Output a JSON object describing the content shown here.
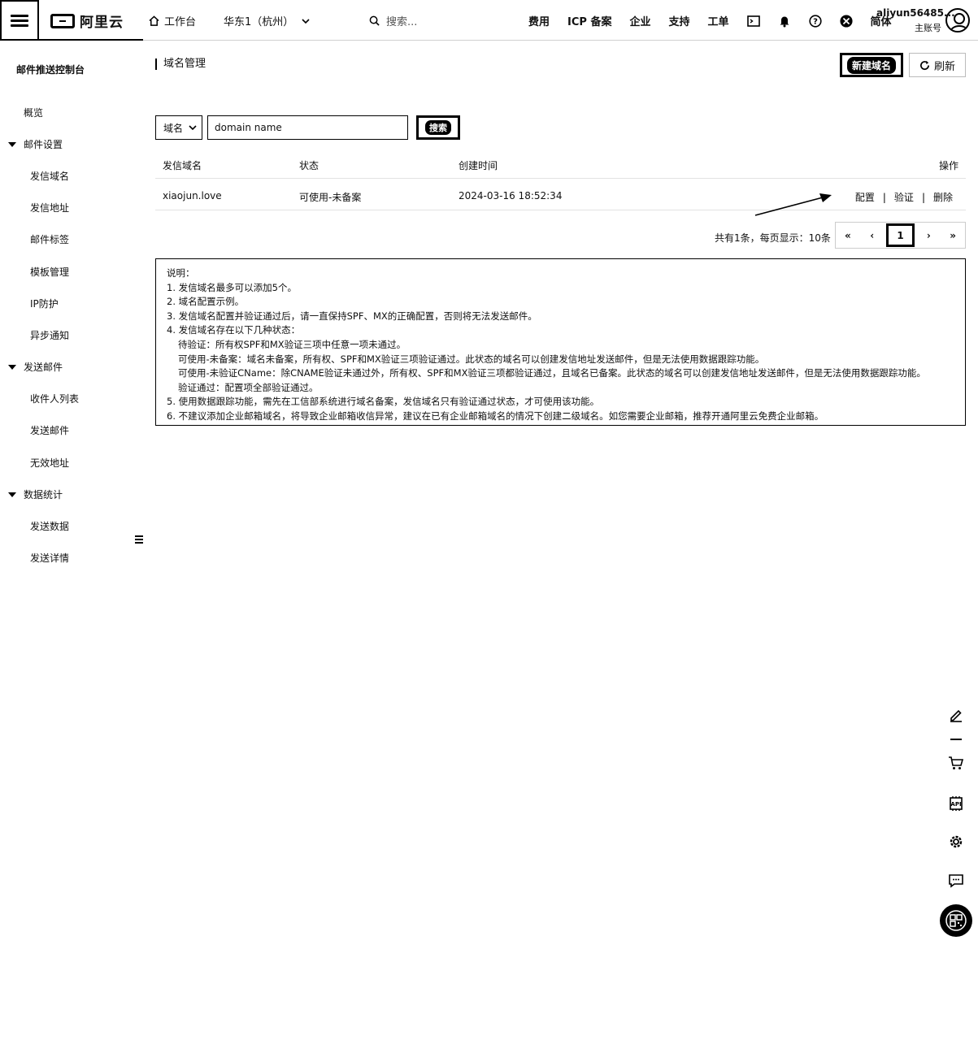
{
  "topbar": {
    "brand": "阿里云",
    "workbench": "工作台",
    "region": "华东1（杭州）",
    "search_placeholder": "搜索...",
    "links": [
      "费用",
      "ICP 备案",
      "企业",
      "支持",
      "工单"
    ],
    "lang": "简体",
    "account_name": "aliyun56485...",
    "account_role": "主账号"
  },
  "sidebar": {
    "title": "邮件推送控制台",
    "overview": "概览",
    "groups": [
      {
        "label": "邮件设置",
        "items": [
          "发信域名",
          "发信地址",
          "邮件标签",
          "模板管理",
          "IP防护",
          "异步通知"
        ]
      },
      {
        "label": "发送邮件",
        "items": [
          "收件人列表",
          "发送邮件",
          "无效地址"
        ]
      },
      {
        "label": "数据统计",
        "items": [
          "发送数据",
          "发送详情"
        ]
      }
    ]
  },
  "page": {
    "title": "域名管理",
    "new_button": "新建域名",
    "refresh_button": "刷新"
  },
  "filter": {
    "select_value": "域名",
    "input_value": "domain name",
    "search_button": "搜索"
  },
  "table": {
    "columns": [
      "发信域名",
      "状态",
      "创建时间",
      "操作"
    ],
    "rows": [
      {
        "domain": "xiaojun.love",
        "status": "可使用-未备案",
        "created": "2024-03-16 18:52:34",
        "actions": [
          "配置",
          "验证",
          "删除"
        ]
      }
    ]
  },
  "pagination": {
    "summary": "共有1条，每页显示：10条",
    "first": "«",
    "prev": "‹",
    "current": "1",
    "next": "›",
    "last": "»"
  },
  "notes": {
    "title": "说明：",
    "lines": [
      "1. 发信域名最多可以添加5个。",
      "2. 域名配置示例。",
      "3. 发信域名配置并验证通过后，请一直保持SPF、MX的正确配置，否则将无法发送邮件。",
      "4. 发信域名存在以下几种状态："
    ],
    "status_lines": [
      "待验证：所有权SPF和MX验证三项中任意一项未通过。",
      "可使用-未备案：域名未备案，所有权、SPF和MX验证三项验证通过。此状态的域名可以创建发信地址发送邮件，但是无法使用数据跟踪功能。",
      "可使用-未验证CName：除CNAME验证未通过外，所有权、SPF和MX验证三项都验证通过，且域名已备案。此状态的域名可以创建发信地址发送邮件，但是无法使用数据跟踪功能。",
      "验证通过：配置项全部验证通过。"
    ],
    "tail_lines": [
      "5. 使用数据跟踪功能，需先在工信部系统进行域名备案，发信域名只有验证通过状态，才可使用该功能。",
      "6. 不建议添加企业邮箱域名，将导致企业邮箱收信异常，建议在已有企业邮箱域名的情况下创建二级域名。如您需要企业邮箱，推荐开通阿里云免费企业邮箱。"
    ]
  },
  "icons": {
    "menu": "menu-icon",
    "home": "home-icon",
    "search": "search-icon",
    "bell": "bell-icon",
    "help": "help-icon",
    "refresh": "refresh-icon",
    "edit": "edit-icon",
    "cart": "cart-icon",
    "settings": "gear-icon",
    "chat": "chat-icon",
    "qr": "qr-icon"
  }
}
